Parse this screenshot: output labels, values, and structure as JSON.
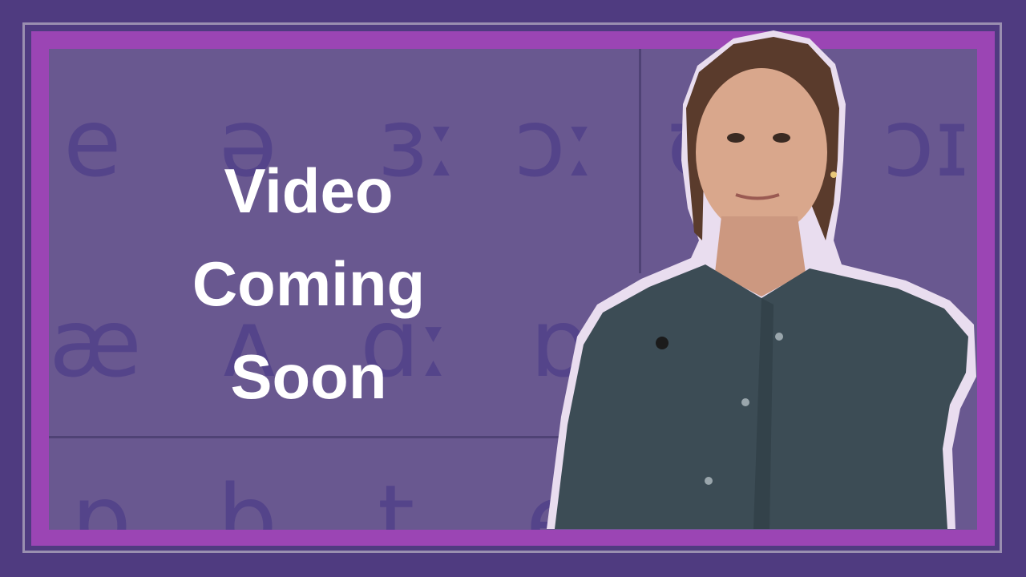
{
  "title_lines": [
    "Video",
    "Coming",
    "Soon"
  ],
  "ipa_symbols": {
    "row1": [
      "e",
      "ə",
      "ɜː",
      "ɔː",
      "ʊ",
      "ɔɪ"
    ],
    "row2": [
      "æ",
      "ʌ",
      "ɑː",
      "ɒ"
    ],
    "row3": [
      "p",
      "b",
      "t",
      "e"
    ]
  },
  "colors": {
    "background": "#4f3b80",
    "frame": "#9b45b4",
    "panel": "#695890",
    "glyph": "#54448a",
    "title": "#ffffff"
  }
}
